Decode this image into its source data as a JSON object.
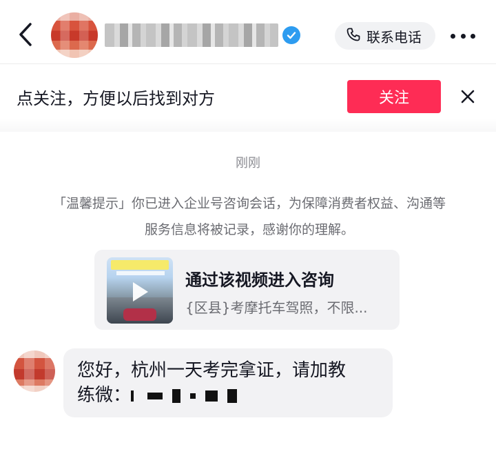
{
  "header": {
    "contact_label": "联系电话",
    "icons": [
      "back-arrow-icon",
      "verified-badge-icon",
      "phone-icon",
      "more-icon"
    ]
  },
  "follow_banner": {
    "text": "点关注，方便以后找到对方",
    "button_label": "关注",
    "button_color": "#fe2c55"
  },
  "chat": {
    "timestamp": "刚刚",
    "notice": "「温馨提示」你已进入企业号咨询会话，为保障消费者权益、沟通等服务信息将被记录，感谢你的理解。",
    "video_card": {
      "title": "通过该视频进入咨询",
      "subtitle": "{区县}考摩托车驾照，不限..."
    },
    "message": {
      "line1": "您好，杭州一天考完拿证，请加教",
      "line2": "练微："
    }
  }
}
